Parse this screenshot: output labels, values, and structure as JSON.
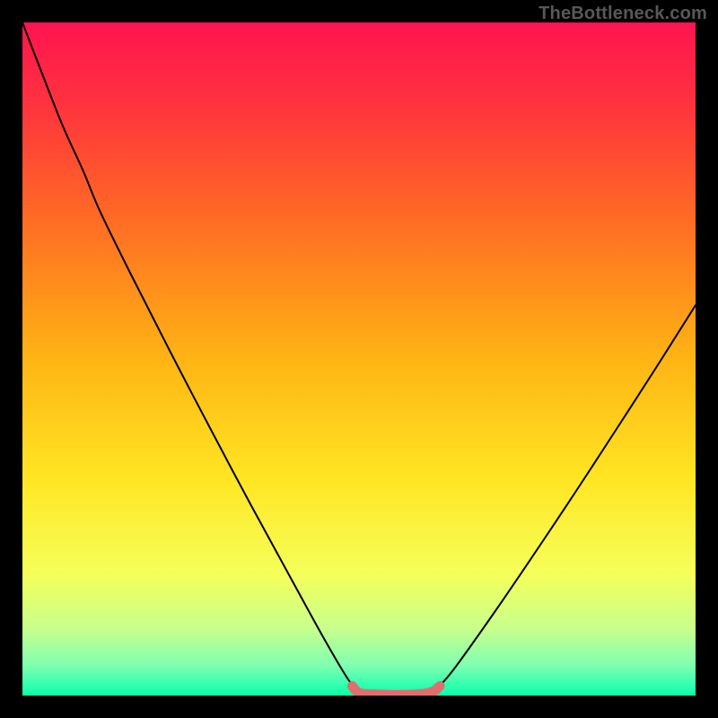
{
  "watermark": "TheBottleneck.com",
  "chart_data": {
    "type": "line",
    "title": "",
    "xlabel": "",
    "ylabel": "",
    "xlim": [
      0,
      1
    ],
    "ylim": [
      0,
      1
    ],
    "background_gradient": {
      "stops": [
        {
          "offset": 0.0,
          "color": "#ff1450"
        },
        {
          "offset": 0.12,
          "color": "#ff323e"
        },
        {
          "offset": 0.3,
          "color": "#ff6e23"
        },
        {
          "offset": 0.5,
          "color": "#ffb414"
        },
        {
          "offset": 0.68,
          "color": "#ffe623"
        },
        {
          "offset": 0.82,
          "color": "#f5ff5a"
        },
        {
          "offset": 0.9,
          "color": "#c8ff8c"
        },
        {
          "offset": 0.955,
          "color": "#80ffb0"
        },
        {
          "offset": 0.985,
          "color": "#30ffb0"
        },
        {
          "offset": 1.0,
          "color": "#0affa8"
        }
      ]
    },
    "series": [
      {
        "name": "bottleneck-curve-left",
        "color": "#000000",
        "width": 2,
        "points": [
          {
            "x": 0.0,
            "y": 1.0
          },
          {
            "x": 0.03,
            "y": 0.922
          },
          {
            "x": 0.06,
            "y": 0.846
          },
          {
            "x": 0.09,
            "y": 0.78
          },
          {
            "x": 0.115,
            "y": 0.72
          },
          {
            "x": 0.16,
            "y": 0.628
          },
          {
            "x": 0.22,
            "y": 0.51
          },
          {
            "x": 0.28,
            "y": 0.395
          },
          {
            "x": 0.34,
            "y": 0.282
          },
          {
            "x": 0.4,
            "y": 0.172
          },
          {
            "x": 0.445,
            "y": 0.09
          },
          {
            "x": 0.48,
            "y": 0.03
          },
          {
            "x": 0.495,
            "y": 0.01
          }
        ]
      },
      {
        "name": "bottleneck-curve-right",
        "color": "#000000",
        "width": 2,
        "points": [
          {
            "x": 0.615,
            "y": 0.01
          },
          {
            "x": 0.64,
            "y": 0.038
          },
          {
            "x": 0.7,
            "y": 0.122
          },
          {
            "x": 0.76,
            "y": 0.21
          },
          {
            "x": 0.82,
            "y": 0.3
          },
          {
            "x": 0.88,
            "y": 0.392
          },
          {
            "x": 0.94,
            "y": 0.485
          },
          {
            "x": 1.0,
            "y": 0.58
          }
        ]
      },
      {
        "name": "bottom-highlight",
        "color": "#e06e6e",
        "width": 11,
        "points": [
          {
            "x": 0.49,
            "y": 0.014
          },
          {
            "x": 0.5,
            "y": 0.004
          },
          {
            "x": 0.52,
            "y": 0.002
          },
          {
            "x": 0.555,
            "y": 0.001
          },
          {
            "x": 0.59,
            "y": 0.002
          },
          {
            "x": 0.61,
            "y": 0.006
          },
          {
            "x": 0.62,
            "y": 0.014
          }
        ]
      }
    ]
  }
}
